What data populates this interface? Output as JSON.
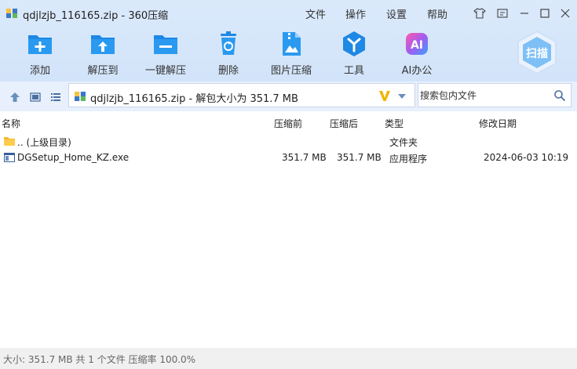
{
  "window": {
    "title": "qdjlzjb_116165.zip - 360压缩",
    "menus": [
      "文件",
      "操作",
      "设置",
      "帮助"
    ]
  },
  "toolbar": {
    "buttons": [
      {
        "label": "添加",
        "icon": "add-icon"
      },
      {
        "label": "解压到",
        "icon": "extract-to-icon"
      },
      {
        "label": "一键解压",
        "icon": "one-click-extract-icon"
      },
      {
        "label": "删除",
        "icon": "delete-icon"
      },
      {
        "label": "图片压缩",
        "icon": "image-compress-icon"
      },
      {
        "label": "工具",
        "icon": "tools-icon"
      },
      {
        "label": "AI办公",
        "icon": "ai-office-icon"
      }
    ],
    "scan_label": "扫描",
    "ai_badge": "AI"
  },
  "address": {
    "path_text": "qdjlzjb_116165.zip - 解包大小为 351.7 MB",
    "search_placeholder": "搜索包内文件"
  },
  "columns": {
    "name": "名称",
    "compressed": "压缩前",
    "after": "压缩后",
    "type": "类型",
    "modified": "修改日期"
  },
  "rows": [
    {
      "name": ".. (上级目录)",
      "compressed": "",
      "after": "",
      "type": "文件夹",
      "modified": ""
    },
    {
      "name": "DGSetup_Home_KZ.exe",
      "compressed": "351.7 MB",
      "after": "351.7 MB",
      "type": "应用程序",
      "modified": "2024-06-03 10:19"
    }
  ],
  "status": {
    "text": "大小: 351.7 MB 共 1 个文件 压缩率 100.0%"
  },
  "colors": {
    "accent": "#2a8fe0",
    "toolbar_bg": "#d6e6fa",
    "v_icon": "#f0b400"
  }
}
